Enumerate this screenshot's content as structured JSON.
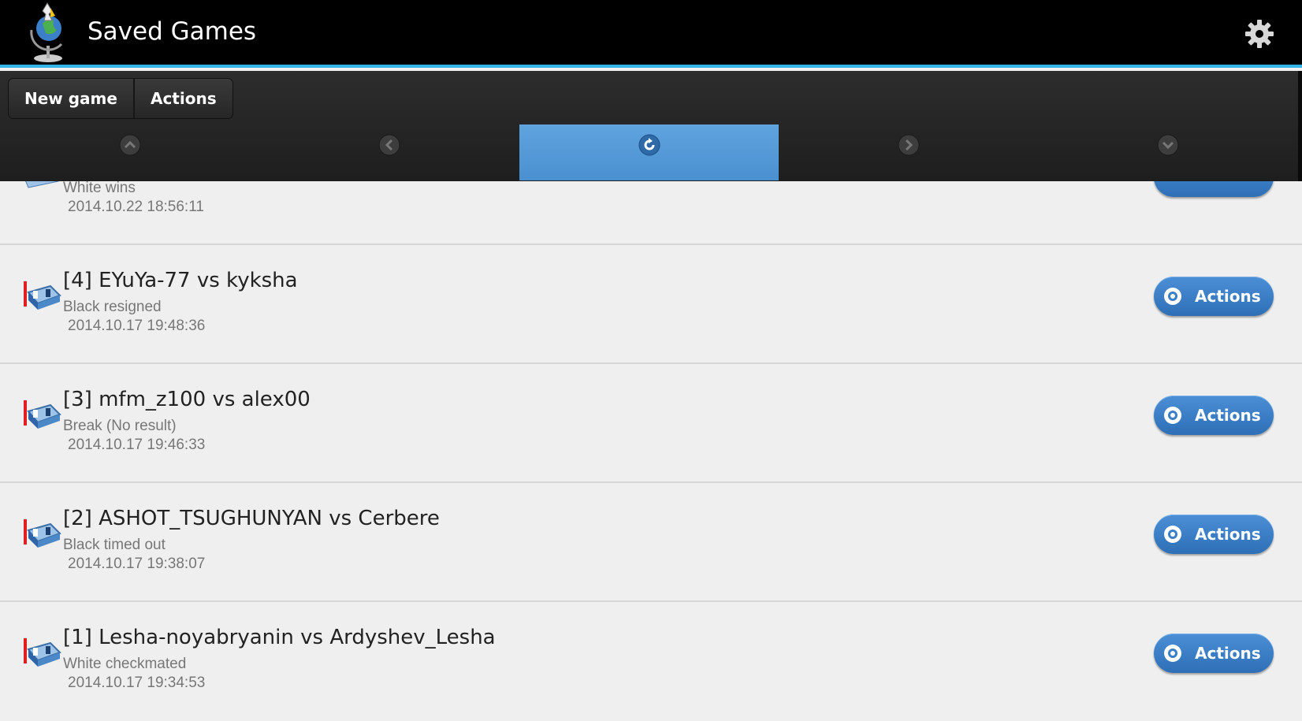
{
  "app": {
    "title": "Saved Games",
    "logo_icon": "chess-globe-logo",
    "settings_icon": "gear-icon"
  },
  "toolbar": {
    "new_game_label": "New game",
    "actions_label": "Actions"
  },
  "nav": {
    "items": [
      {
        "icon": "chevron-up-icon"
      },
      {
        "icon": "chevron-left-icon"
      },
      {
        "icon": "refresh-icon",
        "active": true
      },
      {
        "icon": "chevron-right-icon"
      },
      {
        "icon": "chevron-down-icon"
      }
    ]
  },
  "games": [
    {
      "title": "",
      "status": "White wins",
      "date": "2014.10.22 18:56:11",
      "partial": true
    },
    {
      "title": "[4] EYuYa-77 vs kyksha",
      "status": "Black resigned",
      "date": "2014.10.17 19:48:36",
      "action_label": "Actions"
    },
    {
      "title": "[3] mfm_z100 vs alex00",
      "status": "Break (No result)",
      "date": "2014.10.17 19:46:33",
      "action_label": "Actions"
    },
    {
      "title": "[2] ASHOT_TSUGHUNYAN vs Cerbere",
      "status": "Black timed out",
      "date": "2014.10.17 19:38:07",
      "action_label": "Actions"
    },
    {
      "title": "[1] Lesha-noyabryanin vs Ardyshev_Lesha",
      "status": "White checkmated",
      "date": "2014.10.17 19:34:53",
      "action_label": "Actions"
    }
  ],
  "colors": {
    "accent": "#33b5e5",
    "nav_active": "#5fa4de",
    "action_button": "#3a7fc8"
  }
}
